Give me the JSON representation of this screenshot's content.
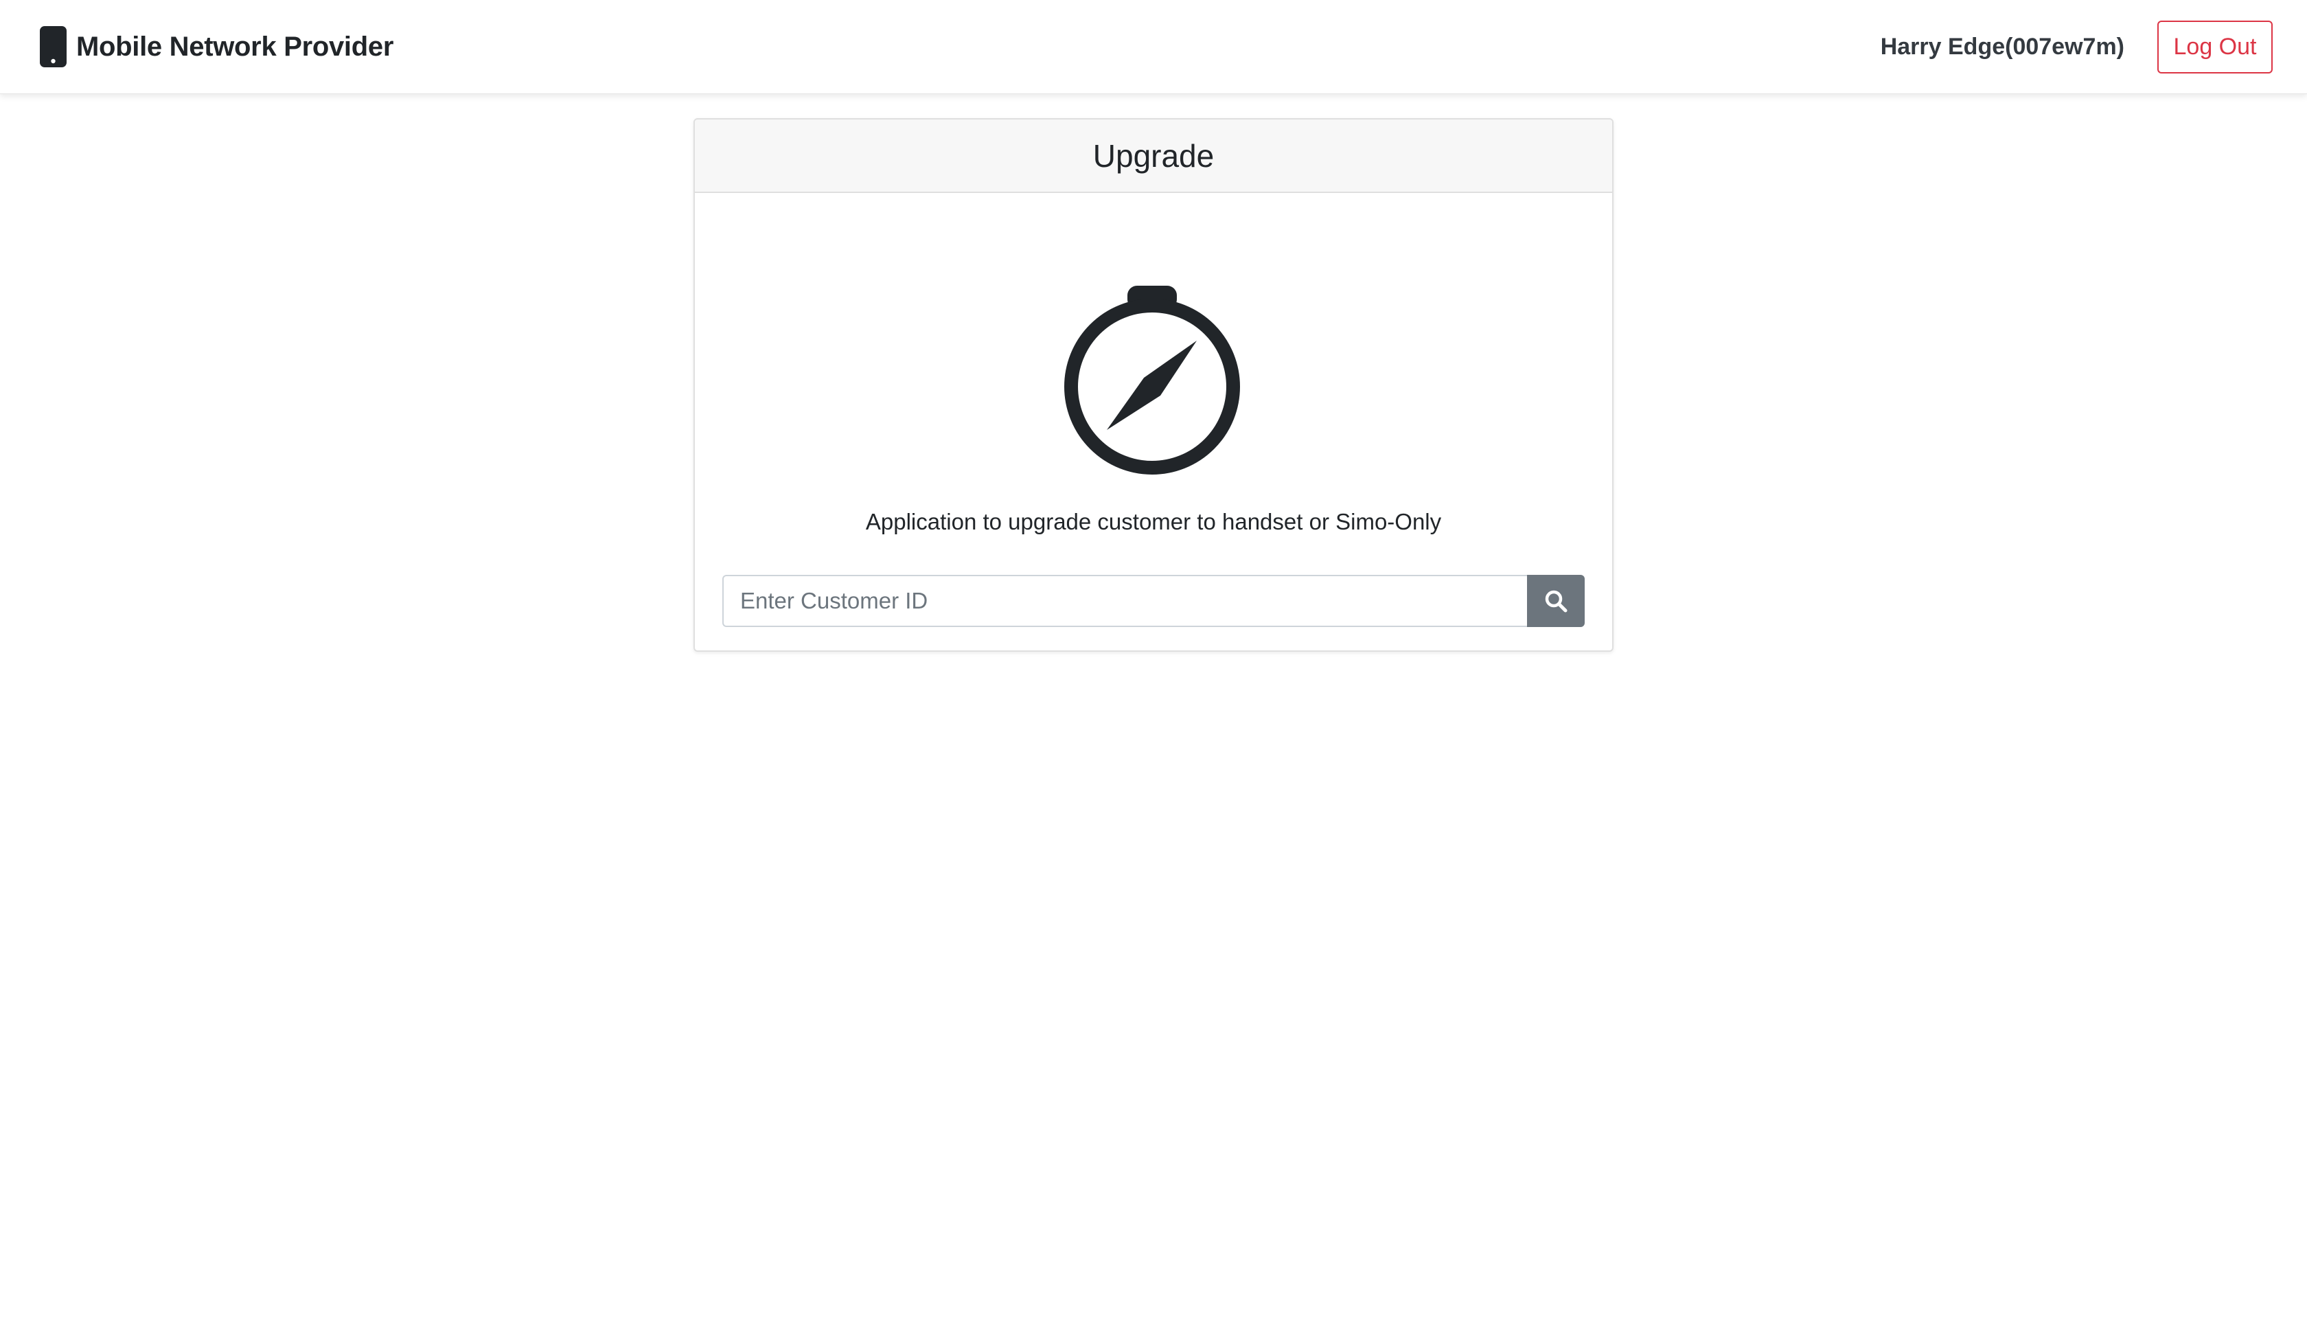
{
  "navbar": {
    "brand_icon": "mobile-phone-icon",
    "brand_name": "Mobile Network Provider",
    "user_name": "Harry Edge(007ew7m)",
    "logout_label": "Log Out"
  },
  "card": {
    "title": "Upgrade",
    "icon": "compass-icon",
    "description": "Application to upgrade customer to handset or Simo-Only",
    "search": {
      "placeholder": "Enter Customer ID",
      "value": "",
      "button_icon": "search-icon"
    }
  },
  "colors": {
    "danger": "#dc3545",
    "secondary": "#6c757d",
    "text": "#212529",
    "header_bg": "#f7f7f7"
  }
}
